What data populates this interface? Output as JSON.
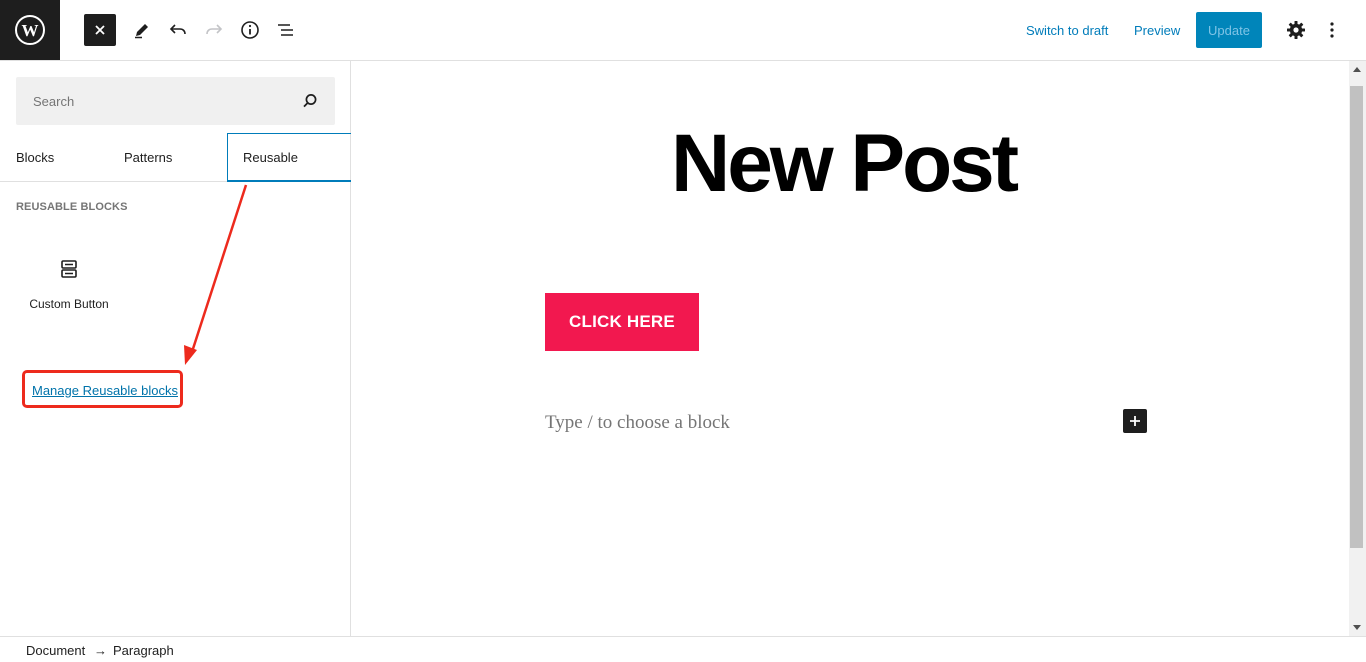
{
  "toolbar": {
    "switch_to_draft": "Switch to draft",
    "preview": "Preview",
    "update": "Update",
    "icons": [
      "wordpress-logo",
      "close-icon",
      "pencil-icon",
      "undo-icon",
      "redo-icon",
      "info-icon",
      "list-view-icon",
      "settings-gear-icon",
      "more-vertical-icon"
    ]
  },
  "inserter": {
    "search_placeholder": "Search",
    "tabs": [
      "Blocks",
      "Patterns",
      "Reusable"
    ],
    "active_tab": "Reusable",
    "section_title": "REUSABLE BLOCKS",
    "blocks": [
      {
        "label": "Custom Button",
        "icon": "reusable-block-icon"
      }
    ],
    "manage_link": "Manage Reusable blocks"
  },
  "editor": {
    "title": "New Post",
    "button_label": "CLICK HERE",
    "placeholder": "Type / to choose a block"
  },
  "breadcrumb": {
    "items": [
      "Document",
      "Paragraph"
    ],
    "separator": "→"
  },
  "colors": {
    "accent": "#007cba",
    "update_button": "#0085ba",
    "cta_button": "#f2184f",
    "annotation": "#ed2a1d"
  }
}
